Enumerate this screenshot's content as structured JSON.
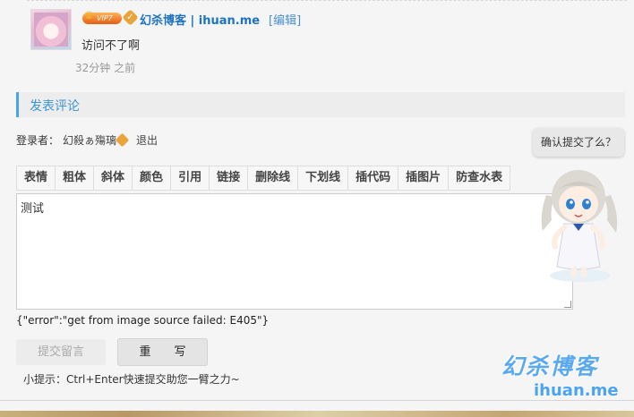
{
  "comment": {
    "vip_label": "VIP7",
    "author": "幻杀博客 | ihuan.me",
    "edit_label": "[编辑]",
    "text": "访问不了啊",
    "time": "32分钟 之前"
  },
  "reply_section": {
    "title": "发表评论"
  },
  "login": {
    "label": "登录者：",
    "username": "幻殺ぁ殤璃",
    "logout_label": "退出"
  },
  "toolbar": {
    "buttons": [
      "表情",
      "粗体",
      "斜体",
      "颜色",
      "引用",
      "链接",
      "删除线",
      "下划线",
      "插代码",
      "插图片",
      "防查水表"
    ]
  },
  "editor": {
    "value": "测试"
  },
  "error_message": "{\"error\":\"get from image source failed: E405\"}",
  "actions": {
    "submit_label": "提交留言",
    "reset_label": "重　　写"
  },
  "tip": "小提示：Ctrl+Enter快速提交助您一臂之力~",
  "confirm_bubble": "确认提交了么？",
  "watermark": {
    "cn": "幻杀博客",
    "en": "ihuan.me"
  },
  "colors": {
    "accent": "#4ba3e0",
    "link": "#1e73be",
    "vip": "#e55d12"
  }
}
